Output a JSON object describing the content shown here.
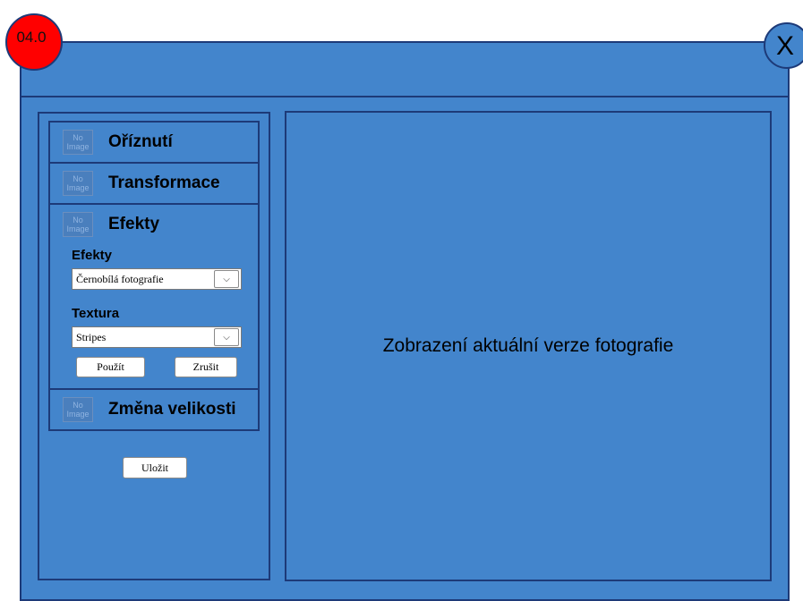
{
  "badge": {
    "label": "04.0"
  },
  "window": {
    "close_label": "X"
  },
  "accordion": {
    "no_image": [
      "No",
      "Image"
    ],
    "sections": [
      {
        "title": "Oříznutí"
      },
      {
        "title": "Transformace"
      },
      {
        "title": "Efekty",
        "effects_label": "Efekty",
        "effects_value": "Černobílá fotografie",
        "texture_label": "Textura",
        "texture_value": "Stripes",
        "apply_label": "Použít",
        "cancel_label": "Zrušit"
      },
      {
        "title": "Změna velikosti"
      }
    ]
  },
  "save_label": "Uložit",
  "preview": {
    "text": "Zobrazení aktuální verze fotografie"
  },
  "colors": {
    "window_bg": "#4385cc",
    "border": "#1d3a78",
    "badge": "#ff0000"
  },
  "icons": {
    "dropdown": "chevron-down-icon",
    "close": "close-icon",
    "placeholder": "image-placeholder-icon"
  }
}
